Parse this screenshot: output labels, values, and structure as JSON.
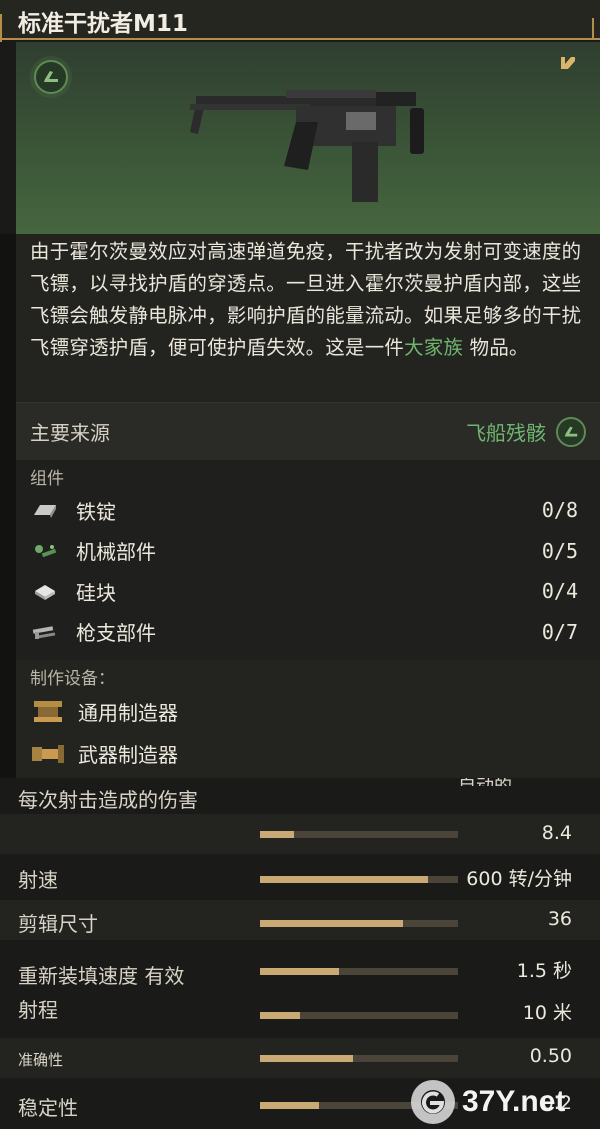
{
  "item": {
    "name": "标准干扰者M11",
    "description_parts": [
      "由于霍尔茨曼效应对高速弹道免疫，干扰者改为发射可变速度的飞镖，以寻找护盾的穿透点。一旦进入霍尔茨曼护盾内部，这些飞镖会触发静电脉冲，影响护盾的能量流动。如果足够多的干扰飞镖穿透护盾，便可使护盾失效。这是一件",
      "大家族",
      " 物品。"
    ],
    "rarity_icon": "rarity-badge-icon",
    "corner_icon": "faction-tag-icon"
  },
  "source": {
    "label": "主要来源",
    "value": "飞船残骸"
  },
  "components": {
    "title": "组件",
    "items": [
      {
        "name": "铁锭",
        "count": "0/8",
        "icon": "iron-ingot-icon"
      },
      {
        "name": "机械部件",
        "count": "0/5",
        "icon": "mechanical-parts-icon"
      },
      {
        "name": "硅块",
        "count": "0/4",
        "icon": "silicon-block-icon"
      },
      {
        "name": "枪支部件",
        "count": "0/7",
        "icon": "gun-parts-icon"
      }
    ]
  },
  "stations": {
    "title": "制作设备：",
    "items": [
      {
        "name": "通用制造器",
        "icon": "fabricator-icon"
      },
      {
        "name": "武器制造器",
        "icon": "weapon-fabricator-icon"
      }
    ]
  },
  "stats": {
    "mode_text": "自动的",
    "rows": [
      {
        "label": "每次射击造成的伤害",
        "value": "",
        "fill": null
      },
      {
        "label": "",
        "value": "8.4",
        "fill": 0.17
      },
      {
        "label": "射速",
        "value": "600 转/分钟",
        "fill": 0.85
      },
      {
        "label": "剪辑尺寸",
        "value": "36",
        "fill": 0.72
      },
      {
        "label": "重新装填速度 有效",
        "value": "1.5 秒",
        "fill": 0.4
      },
      {
        "label": "射程",
        "value": "10 米",
        "fill": 0.2
      },
      {
        "label": "准确性",
        "value": "0.50",
        "fill": 0.47
      },
      {
        "label": "稳定性",
        "value": "0.2",
        "fill": 0.3
      }
    ]
  },
  "watermark": {
    "text": "37Y.net"
  }
}
